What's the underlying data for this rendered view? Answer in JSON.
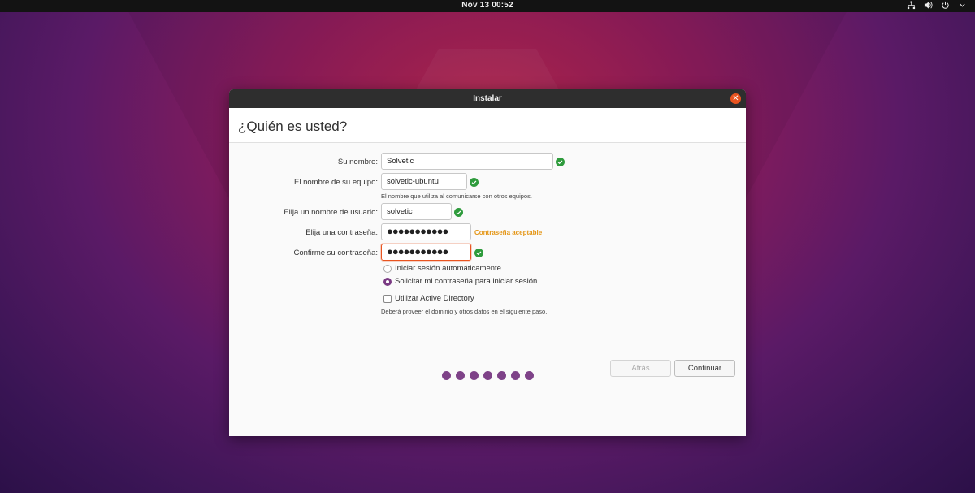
{
  "topbar": {
    "clock": "Nov 13  00:52",
    "icons": [
      "network-icon",
      "volume-icon",
      "power-icon",
      "chevron-down-icon"
    ]
  },
  "window": {
    "title": "Instalar",
    "heading": "¿Quién es usted?"
  },
  "form": {
    "name_label": "Su nombre:",
    "name_value": "Solvetic",
    "computer_label": "El nombre de su equipo:",
    "computer_value": "solvetic-ubuntu",
    "computer_hint": "El nombre que utiliza al comunicarse con otros equipos.",
    "username_label": "Elija un nombre de usuario:",
    "username_value": "solvetic",
    "password_label": "Elija una contraseña:",
    "password_value": "●●●●●●●●●●●",
    "password_status": "Contraseña aceptable",
    "confirm_label": "Confirme su contraseña:",
    "confirm_value": "●●●●●●●●●●●",
    "auto_login_label": "Iniciar sesión automáticamente",
    "require_password_label": "Solicitar mi contraseña para iniciar sesión",
    "selected_login_option": "require_password",
    "active_directory_label": "Utilizar Active Directory",
    "active_directory_checked": false,
    "active_directory_hint": "Deberá proveer el dominio y otros datos en el siguiente paso."
  },
  "buttons": {
    "back": "Atrás",
    "continue": "Continuar"
  },
  "progress": {
    "steps": 7
  },
  "colors": {
    "accent": "#e95420",
    "ok": "#2e9b3c",
    "progress_dot": "#7e4288",
    "warning_text": "#e49616"
  }
}
